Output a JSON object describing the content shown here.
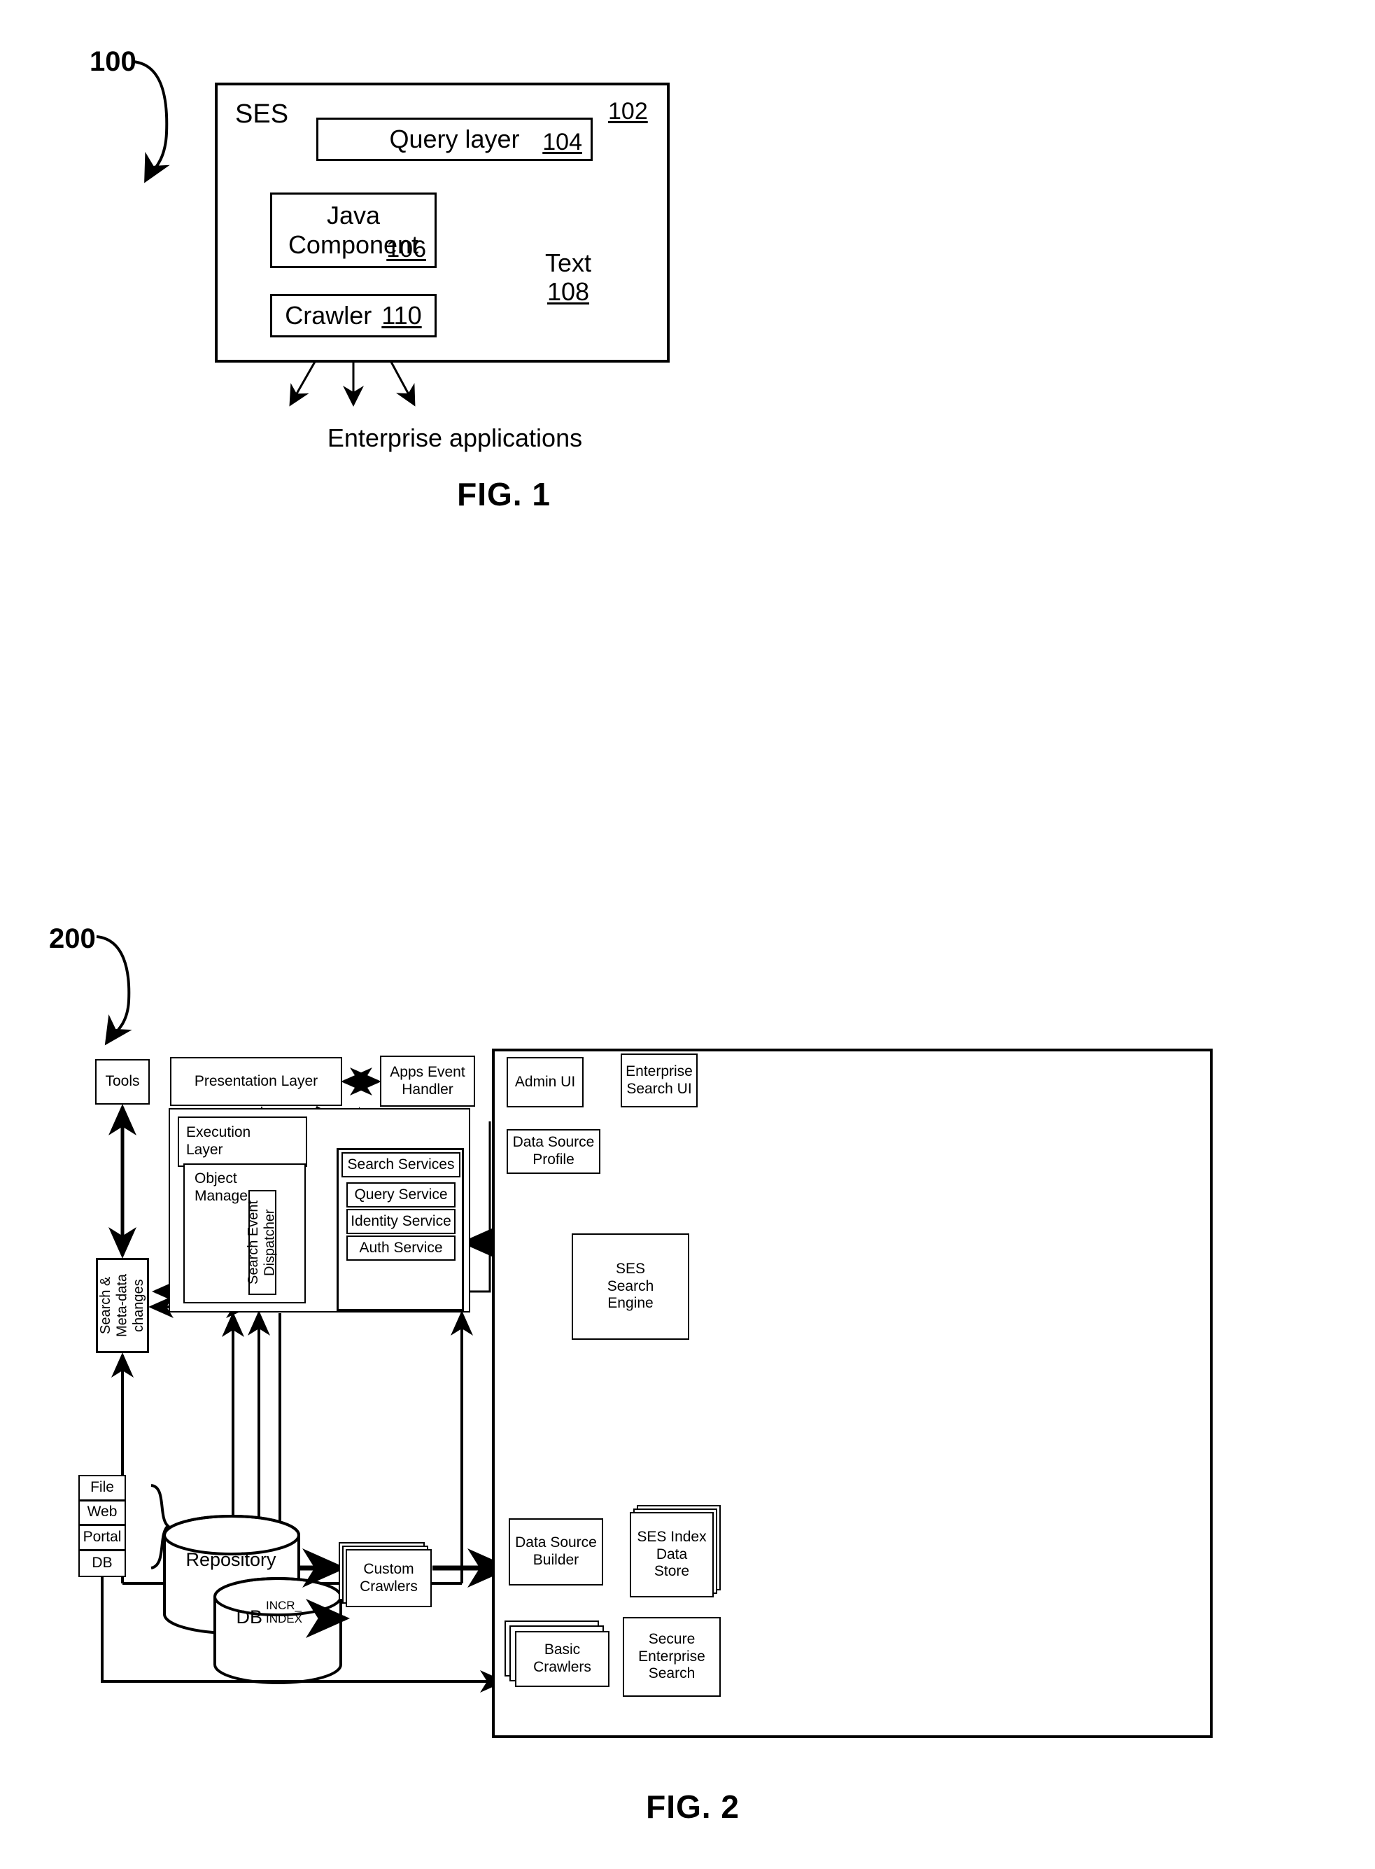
{
  "figure1": {
    "lead_label": "100",
    "caption": "FIG. 1",
    "outer_box_title": "SES",
    "outer_box_ref": "102",
    "blocks": [
      {
        "label": "Query layer",
        "ref": "104"
      },
      {
        "label": "Java Component",
        "ref": "106"
      },
      {
        "label": "Crawler",
        "ref": "110"
      }
    ],
    "datastore": {
      "label": "Text",
      "ref": "108"
    },
    "bottom_label": "Enterprise applications",
    "java_line1": "Java",
    "java_line2": "Component"
  },
  "figure2": {
    "lead_label": "200",
    "caption": "FIG. 2",
    "tools": "Tools",
    "presentation_layer": "Presentation Layer",
    "apps_event_handler_line1": "Apps Event",
    "apps_event_handler_line2": "Handler",
    "execution_layer_line1": "Execution",
    "execution_layer_line2": "Layer",
    "object_manager_line1": "Object",
    "object_manager_line2": "Manager",
    "search_event_dispatcher": "Search Event Dispatcher",
    "search_services": "Search Services",
    "query_service": "Query Service",
    "identity_service": "Identity Service",
    "auth_service": "Auth Service",
    "search_metadata_changes": "Search & Meta-data changes",
    "sources": [
      "File",
      "Web",
      "Portal",
      "DB"
    ],
    "repository": "Repository",
    "db_label": "DB",
    "incr_index_line1": "INCR_",
    "incr_index_line2": "INDEX",
    "custom_crawlers_line1": "Custom",
    "custom_crawlers_line2": "Crawlers",
    "admin_ui": "Admin UI",
    "enterprise_search_ui_line1": "Enterprise",
    "enterprise_search_ui_line2": "Search UI",
    "data_source_profile_line1": "Data Source",
    "data_source_profile_line2": "Profile",
    "ses_search_engine_line1": "SES",
    "ses_search_engine_line2": "Search",
    "ses_search_engine_line3": "Engine",
    "data_source_builder_line1": "Data Source",
    "data_source_builder_line2": "Builder",
    "ses_index_data_store_line1": "SES Index",
    "ses_index_data_store_line2": "Data",
    "ses_index_data_store_line3": "Store",
    "secure_enterprise_search_line1": "Secure",
    "secure_enterprise_search_line2": "Enterprise",
    "secure_enterprise_search_line3": "Search",
    "basic_crawlers_line1": "Basic",
    "basic_crawlers_line2": "Crawlers"
  },
  "colors": {
    "ink": "#000000",
    "paper": "#ffffff"
  }
}
